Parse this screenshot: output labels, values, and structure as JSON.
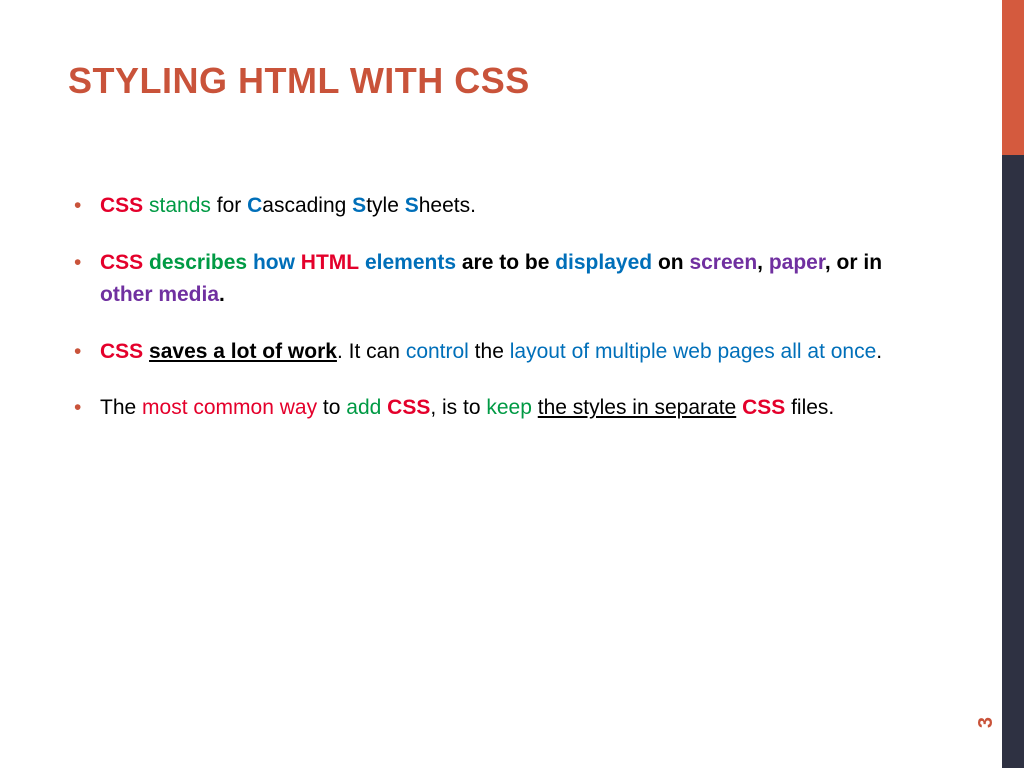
{
  "title": "STYLING HTML WITH CSS",
  "pageNumber": "3",
  "bullets": [
    [
      {
        "t": "CSS",
        "cls": "b c-red"
      },
      {
        "t": " "
      },
      {
        "t": "stands",
        "cls": "c-green"
      },
      {
        "t": " for "
      },
      {
        "t": "C",
        "cls": "b c-blue"
      },
      {
        "t": "ascading "
      },
      {
        "t": "S",
        "cls": "b c-blue"
      },
      {
        "t": "tyle "
      },
      {
        "t": "S",
        "cls": "b c-blue"
      },
      {
        "t": "heets."
      }
    ],
    [
      {
        "t": "CSS",
        "cls": "b c-red"
      },
      {
        "t": " "
      },
      {
        "t": "describes",
        "cls": "b c-green"
      },
      {
        "t": " "
      },
      {
        "t": "how",
        "cls": "b c-blue"
      },
      {
        "t": " "
      },
      {
        "t": "HTML",
        "cls": "b c-red"
      },
      {
        "t": " "
      },
      {
        "t": "elements",
        "cls": "b c-blue"
      },
      {
        "t": " ",
        "cls": "b"
      },
      {
        "t": "are to be",
        "cls": "b"
      },
      {
        "t": " "
      },
      {
        "t": "displayed",
        "cls": "b c-blue"
      },
      {
        "t": " ",
        "cls": "b"
      },
      {
        "t": "on",
        "cls": "b"
      },
      {
        "t": " "
      },
      {
        "t": "screen",
        "cls": "b c-purple"
      },
      {
        "t": ", ",
        "cls": "b"
      },
      {
        "t": "paper",
        "cls": "b c-purple"
      },
      {
        "t": ", or in ",
        "cls": "b"
      },
      {
        "t": "other media",
        "cls": "b c-purple"
      },
      {
        "t": ".",
        "cls": "b"
      }
    ],
    [
      {
        "t": "CSS",
        "cls": "b c-red"
      },
      {
        "t": " "
      },
      {
        "t": "saves a lot of work",
        "cls": "b u"
      },
      {
        "t": ". It can "
      },
      {
        "t": "control",
        "cls": "c-blue"
      },
      {
        "t": " the "
      },
      {
        "t": "layout of multiple web pages all at once",
        "cls": "c-blue"
      },
      {
        "t": "."
      }
    ],
    [
      {
        "t": "The "
      },
      {
        "t": "most common way",
        "cls": "c-red"
      },
      {
        "t": " to "
      },
      {
        "t": "add",
        "cls": "c-green"
      },
      {
        "t": " "
      },
      {
        "t": "CSS",
        "cls": "b c-red"
      },
      {
        "t": ", is to "
      },
      {
        "t": "keep",
        "cls": "c-green"
      },
      {
        "t": " "
      },
      {
        "t": "the styles in separate",
        "cls": "u"
      },
      {
        "t": " "
      },
      {
        "t": "CSS",
        "cls": "b c-red"
      },
      {
        "t": " files."
      }
    ]
  ]
}
